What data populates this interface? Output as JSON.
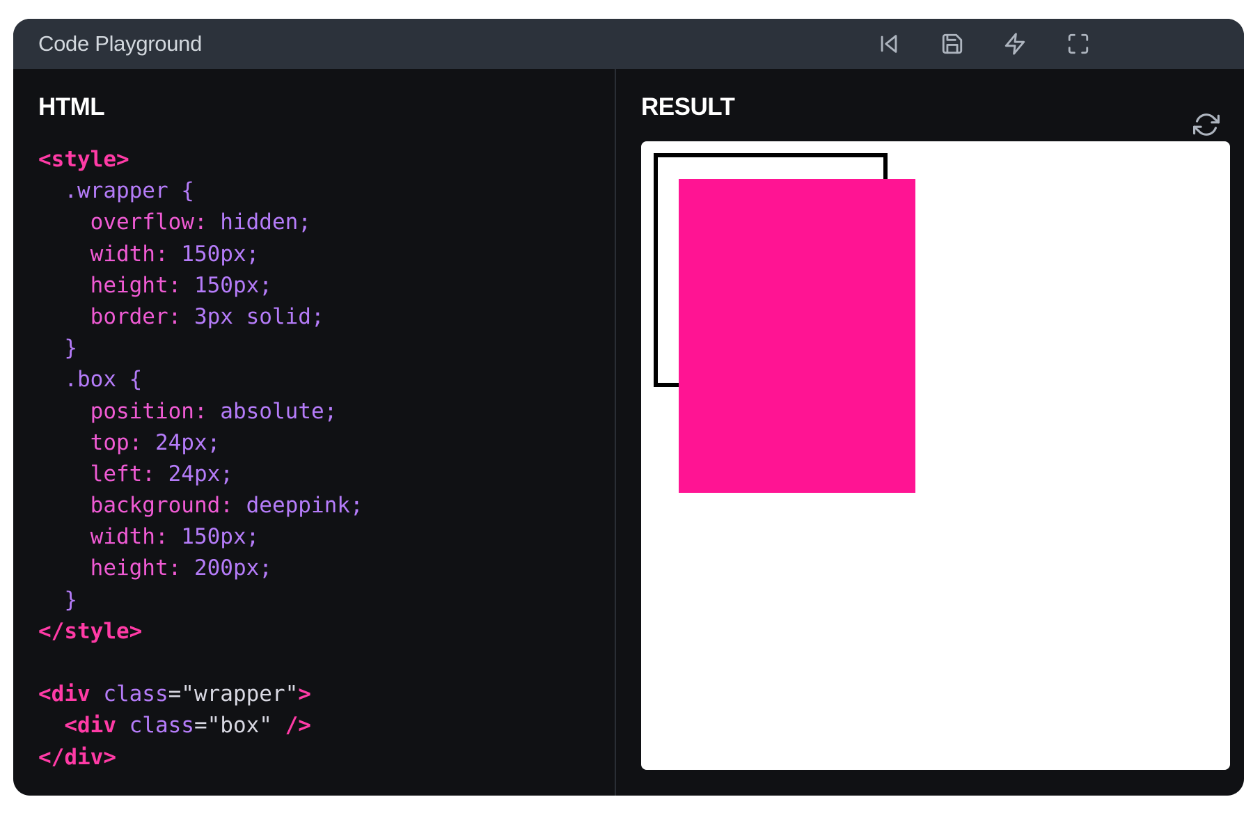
{
  "window": {
    "title": "Code Playground",
    "toolbar": [
      {
        "name": "reset-button",
        "icon": "skip-back-icon"
      },
      {
        "name": "save-button",
        "icon": "save-icon"
      },
      {
        "name": "format-button",
        "icon": "lightning-icon"
      },
      {
        "name": "fullscreen-button",
        "icon": "fullscreen-icon"
      }
    ]
  },
  "editor": {
    "heading": "HTML",
    "lines": [
      [
        {
          "t": "<style>",
          "c": "tag"
        }
      ],
      [
        {
          "t": "  .wrapper {",
          "c": "sel"
        }
      ],
      [
        {
          "t": "    overflow:",
          "c": "prop"
        },
        {
          "t": " hidden;",
          "c": "val"
        }
      ],
      [
        {
          "t": "    width:",
          "c": "prop"
        },
        {
          "t": " 150px;",
          "c": "val"
        }
      ],
      [
        {
          "t": "    height:",
          "c": "prop"
        },
        {
          "t": " 150px;",
          "c": "val"
        }
      ],
      [
        {
          "t": "    border:",
          "c": "prop"
        },
        {
          "t": " 3px solid;",
          "c": "val"
        }
      ],
      [
        {
          "t": "  }",
          "c": "sel"
        }
      ],
      [
        {
          "t": "  .box {",
          "c": "sel"
        }
      ],
      [
        {
          "t": "    position:",
          "c": "prop"
        },
        {
          "t": " absolute;",
          "c": "val"
        }
      ],
      [
        {
          "t": "    top:",
          "c": "prop"
        },
        {
          "t": " 24px;",
          "c": "val"
        }
      ],
      [
        {
          "t": "    left:",
          "c": "prop"
        },
        {
          "t": " 24px;",
          "c": "val"
        }
      ],
      [
        {
          "t": "    background:",
          "c": "prop"
        },
        {
          "t": " deeppink;",
          "c": "val"
        }
      ],
      [
        {
          "t": "    width:",
          "c": "prop"
        },
        {
          "t": " 150px;",
          "c": "val"
        }
      ],
      [
        {
          "t": "    height:",
          "c": "prop"
        },
        {
          "t": " 200px;",
          "c": "val"
        }
      ],
      [
        {
          "t": "  }",
          "c": "sel"
        }
      ],
      [
        {
          "t": "</style>",
          "c": "tag"
        }
      ],
      [
        {
          "t": "",
          "c": "str"
        }
      ],
      [
        {
          "t": "<div",
          "c": "tag"
        },
        {
          "t": " class",
          "c": "attr"
        },
        {
          "t": "=\"wrapper\"",
          "c": "str"
        },
        {
          "t": ">",
          "c": "tag"
        }
      ],
      [
        {
          "t": "  <div",
          "c": "tag"
        },
        {
          "t": " class",
          "c": "attr"
        },
        {
          "t": "=\"box\" ",
          "c": "str"
        },
        {
          "t": "/>",
          "c": "tag"
        }
      ],
      [
        {
          "t": "</div>",
          "c": "tag"
        }
      ]
    ]
  },
  "result": {
    "heading": "RESULT",
    "refresh_icon": "refresh-icon",
    "box_color": "#ff1493",
    "wrapper_border_color": "#000000"
  },
  "colors": {
    "window_bg": "#101114",
    "titlebar_bg": "#2c323b",
    "accent_pink": "#ff3ba6",
    "accent_purple": "#b57cf9"
  }
}
